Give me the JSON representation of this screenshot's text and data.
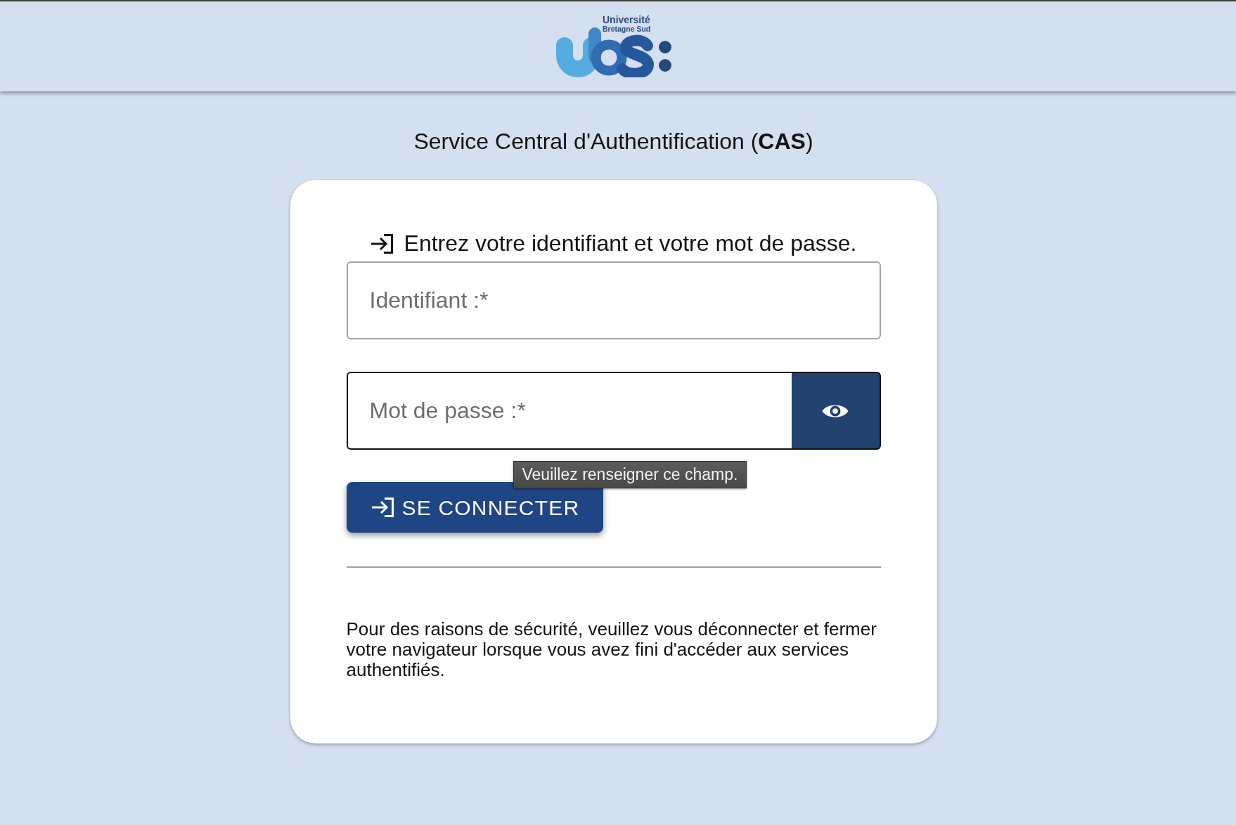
{
  "header": {
    "logo": {
      "lines": [
        "Université",
        "Bretagne Sud"
      ]
    }
  },
  "title": "Service Central d'Authentification (**CAS**)",
  "login_form": {
    "heading": "Entrez votre identifiant et votre mot de passe.",
    "fields": [
      {
        "kind": "text",
        "placeholder": "Identifiant :*",
        "focused": false
      },
      {
        "kind": "password",
        "placeholder": "Mot de passe :*",
        "focused": true,
        "reveal_button": true
      }
    ],
    "tooltip": {
      "text": "Veuillez renseigner ce champ."
    },
    "submit_button": {
      "label": "SE CONNECTER"
    },
    "notice": "Pour des raisons de sécurité, veuillez vous déconnecter et fermer votre navigateur lorsque vous avez fini d'accéder aux services authentifiés."
  }
}
